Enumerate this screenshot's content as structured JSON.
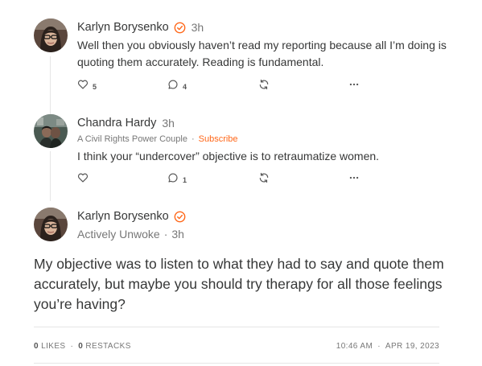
{
  "comments": [
    {
      "author": "Karlyn Borysenko",
      "verified": true,
      "time": "3h",
      "body": "Well then you obviously haven’t read my reporting because all I’m doing is quoting them accurately. Reading is fundamental.",
      "likes": "5",
      "replies": "4"
    },
    {
      "author": "Chandra Hardy",
      "verified": false,
      "time": "3h",
      "publication": "A Civil Rights Power Couple",
      "subscribe_label": "Subscribe",
      "body": "I think your “undercover” objective is to retraumatize women.",
      "likes": "",
      "replies": "1"
    }
  ],
  "main_post": {
    "author": "Karlyn Borysenko",
    "verified": true,
    "publication": "Actively Unwoke",
    "time": "3h",
    "body": "My objective was to listen to what they had to say and quote them accurately, but maybe you should try therapy for all those feelings you’re having?",
    "likes_count": "0",
    "likes_label": "LIKES",
    "restacks_count": "0",
    "restacks_label": "RESTACKS",
    "time_posted": "10:46 AM",
    "date_posted": "APR 19, 2023"
  },
  "separator": "·",
  "icons": {
    "verified": "verified-check-icon",
    "like": "heart-icon",
    "reply": "speech-bubble-icon",
    "restack": "restack-arrows-icon",
    "more": "more-dots-icon"
  },
  "colors": {
    "accent": "#ff6719",
    "text": "#363737",
    "muted": "#777777"
  }
}
